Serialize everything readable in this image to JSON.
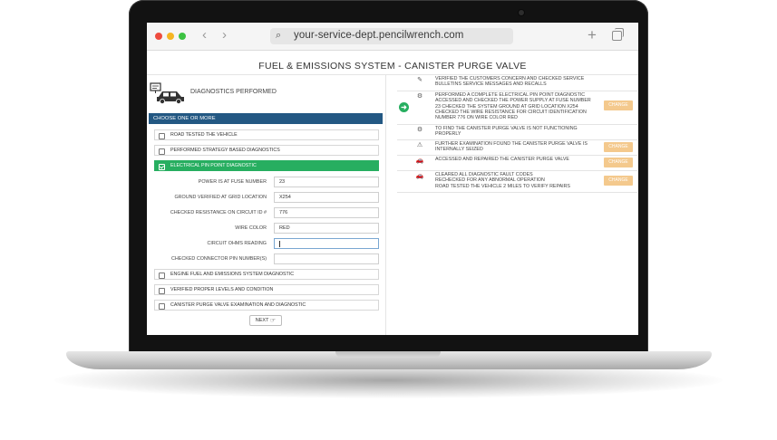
{
  "browser": {
    "url": "your-service-dept.pencilwrench.com",
    "back_glyph": "‹",
    "forward_glyph": "›",
    "search_glyph": "⌕",
    "new_tab_glyph": "+"
  },
  "page": {
    "title": "FUEL & EMISSIONS SYSTEM - CANISTER PURGE VALVE",
    "section_label": "DIAGNOSTICS PERFORMED",
    "choose_header": "CHOOSE ONE OR MORE",
    "next_label": "NEXT",
    "next_icon": "☞"
  },
  "options_top": [
    {
      "label": "ROAD TESTED THE VEHICLE",
      "checked": false
    },
    {
      "label": "PERFORMED STRATEGY BASED DIAGNOSTICS",
      "checked": false
    },
    {
      "label": "ELECTRICAL PIN POINT DIAGNOSTIC",
      "checked": true
    }
  ],
  "fields": [
    {
      "label": "POWER IS AT FUSE NUMBER",
      "value": "23"
    },
    {
      "label": "GROUND VERIFIED AT GRID LOCATION",
      "value": "X254"
    },
    {
      "label": "CHECKED RESISTANCE ON CIRCUIT ID #",
      "value": "776"
    },
    {
      "label": "WIRE COLOR",
      "value": "RED"
    },
    {
      "label": "CIRCUIT OHMS READING",
      "value": ""
    },
    {
      "label": "CHECKED CONNECTOR PIN NUMBER(S)",
      "value": ""
    }
  ],
  "options_bottom": [
    {
      "label": "ENGINE FUEL AND EMISSIONS SYSTEM DIAGNOSTIC",
      "checked": false
    },
    {
      "label": "VERIFIED PROPER LEVELS AND CONDITION",
      "checked": false
    },
    {
      "label": "CANISTER PURGE VALVE EXAMINATION AND DIAGNOSTIC",
      "checked": false
    }
  ],
  "summary": [
    {
      "icon": "✎",
      "text": "VERIFIED THE CUSTOMERS CONCERN AND CHECKED SERVICE\nBULLETINS SERVICE MESSAGES AND RECALLS",
      "change": ""
    },
    {
      "icon": "⚙",
      "text": "PERFORMED A COMPLETE ELECTRICAL PIN POINT DIAGNOSTIC\nACCESSED AND CHECKED THE POWER SUPPLY AT FUSE NUMBER\n23 CHECKED THE SYSTEM GROUND AT GRID LOCATION X254\nCHECKED THE WIRE RESISTANCE FOR CIRCUIT IDENTIFICATION\nNUMBER 776 ON WIRE COLOR RED",
      "change": "CHANGE",
      "arrow": "➜"
    },
    {
      "icon": "⚙",
      "text": "TO FIND THE CANISTER PURGE VALVE IS NOT FUNCTIONING\nPROPERLY",
      "change": ""
    },
    {
      "icon": "⚠",
      "text": "FURTHER EXAMINATION FOUND THE CANISTER PURGE VALVE IS\nINTERNALLY SEIZED",
      "change": "CHANGE"
    },
    {
      "icon": "🚗",
      "text": "ACCESSED AND REPAIRED THE CANISTER PURGE VALVE",
      "change": "CHANGE"
    },
    {
      "icon": "🚗",
      "text": "CLEARED ALL DIAGNOSTIC FAULT CODES\nRECHECKED FOR ANY ABNORMAL OPERATION\nROAD TESTED THE VEHICLE 2 MILES TO VERIFY REPAIRS",
      "change": "CHANGE"
    }
  ]
}
